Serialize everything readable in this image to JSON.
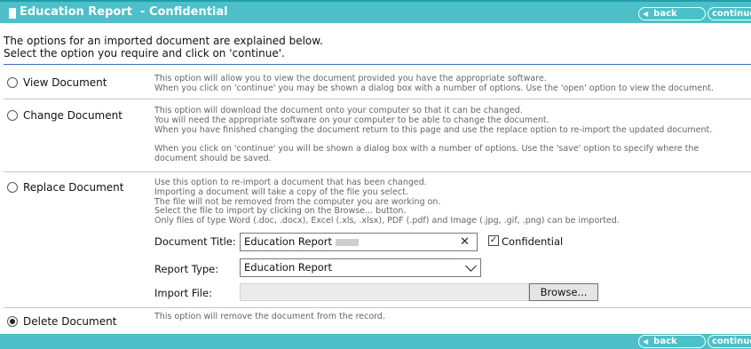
{
  "header": {
    "title": "Education Report  - Confidential",
    "back_label": "back",
    "continue_label": "continue"
  },
  "intro": {
    "line1": "The options for an imported document are explained below.",
    "line2": "Select the option you require and click on 'continue'."
  },
  "options": [
    {
      "label": "View Document",
      "selected": false,
      "description": "This option will allow you to view the document provided you have the appropriate software.\nWhen you click on 'continue' you may be shown a dialog box with a number of options. Use the 'open' option to view the document."
    },
    {
      "label": "Change Document",
      "selected": false,
      "description": "This option will download the document onto your computer so that it can be changed.\nYou will need the appropriate software on your computer to be able to change the document.\nWhen you have finished changing the document return to this page and use the replace option to re-import the updated document.\n\nWhen you click on 'continue' you will be shown a dialog box with a number of options. Use the 'save' option to specify where the\ndocument should be saved."
    },
    {
      "label": "Replace Document",
      "selected": false,
      "description": "Use this option to re-import a document that has been changed.\nImporting a document will take a copy of the file you select.\nThe file will not be removed from the computer you are working on.\nSelect the file to import by clicking on the Browse... button.\nOnly files of type Word (.doc, .docx), Excel (.xls, .xlsx), PDF (.pdf) and Image (.jpg, .gif, .png) can be imported."
    },
    {
      "label": "Delete Document",
      "selected": true,
      "description": "This option will remove the document from the record."
    }
  ],
  "replace_form": {
    "doc_title_label": "Document Title:",
    "doc_title_value": "Education Report",
    "clear_glyph": "✕",
    "confidential_label": "Confidential",
    "confidential_checked": true,
    "report_type_label": "Report Type:",
    "report_type_value": "Education Report",
    "import_file_label": "Import File:",
    "browse_label": "Browse..."
  },
  "colors": {
    "header_bg": "#4cbfc9",
    "accent_line": "#3b6fc4"
  },
  "icons": {
    "title": "document-icon",
    "back": "left-arrow-icon",
    "select": "chevron-down-icon"
  }
}
